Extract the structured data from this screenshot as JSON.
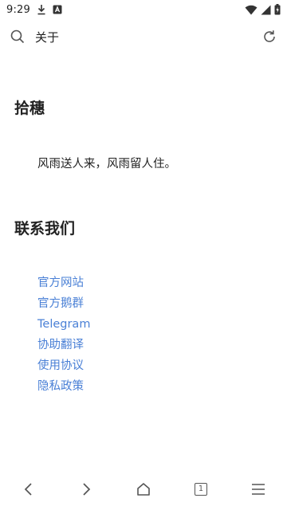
{
  "status_bar": {
    "time": "9:29",
    "icons": [
      "download-icon",
      "notification-app-icon",
      "wifi-icon",
      "cell-signal-icon",
      "battery-icon"
    ]
  },
  "address_bar": {
    "title": "关于",
    "left_icon": "search-icon",
    "right_icon": "reload-icon"
  },
  "sections": {
    "about": {
      "heading": "拾穗",
      "quote": "风雨送人来，风雨留人住。"
    },
    "contact": {
      "heading": "联系我们",
      "links": [
        "官方网站",
        "官方鹅群",
        "Telegram",
        "协助翻译",
        "使用协议",
        "隐私政策"
      ]
    }
  },
  "bottom_nav": {
    "tab_count": "1",
    "items": [
      "back-icon",
      "forward-icon",
      "home-icon",
      "tabs-icon",
      "menu-icon"
    ]
  },
  "colors": {
    "link": "#4a80d6",
    "text": "#222222",
    "icon": "#555555"
  }
}
